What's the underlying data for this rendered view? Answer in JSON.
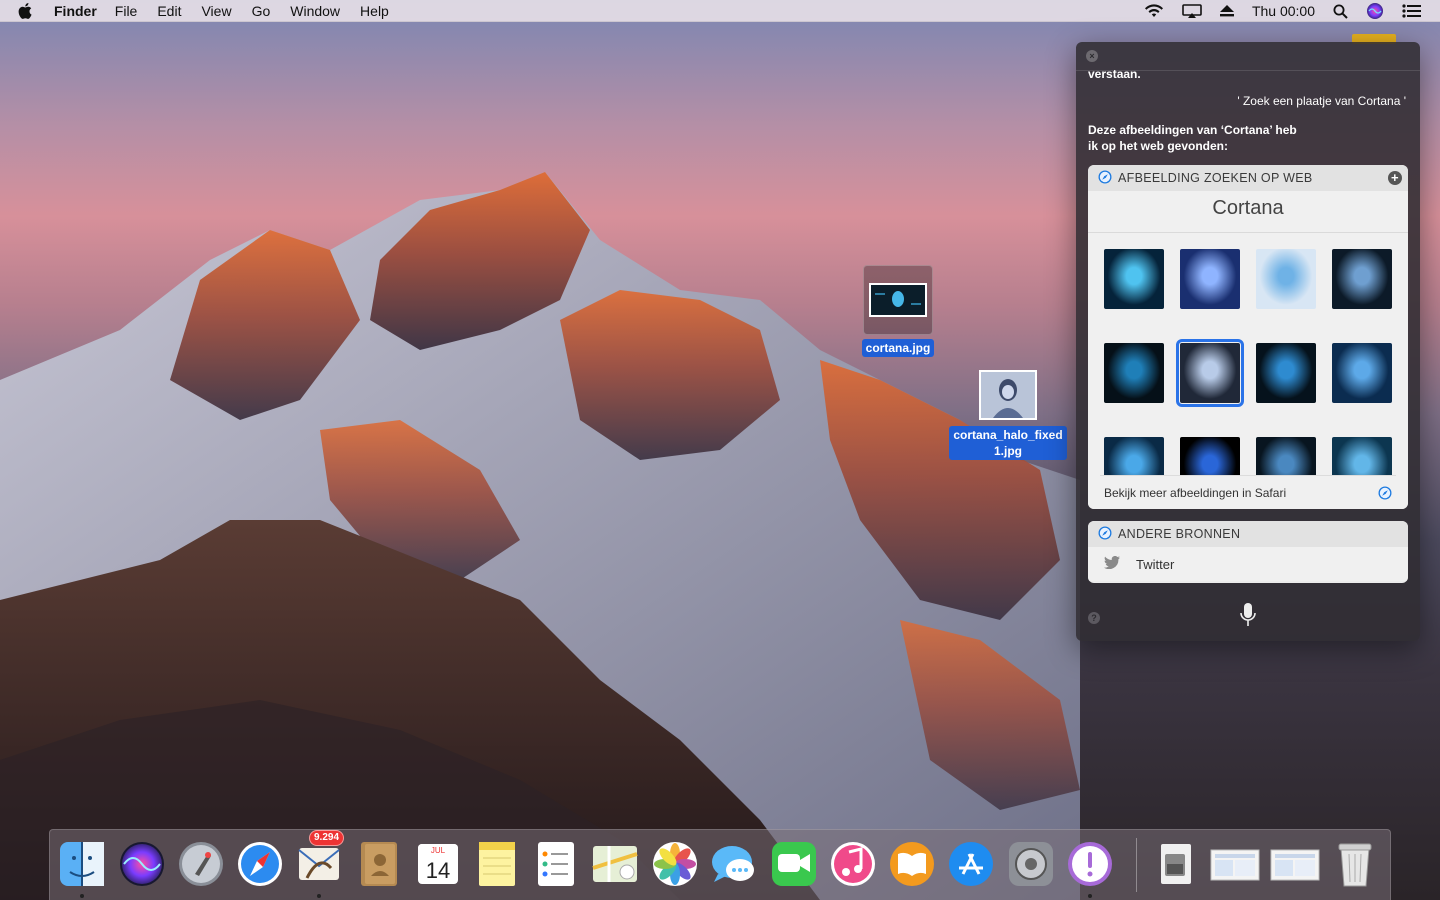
{
  "menubar": {
    "app_name": "Finder",
    "menus": [
      "File",
      "Edit",
      "View",
      "Go",
      "Window",
      "Help"
    ],
    "clock": "Thu 00:00",
    "icons": [
      "apple-icon",
      "wifi-icon",
      "airplay-icon",
      "eject-icon",
      "spotlight-icon",
      "siri-icon",
      "notification-center-icon"
    ]
  },
  "desktop": {
    "files": [
      {
        "name": "cortana.jpg"
      },
      {
        "name": "cortana_halo_fixed",
        "name_line2": "1.jpg"
      }
    ]
  },
  "siri": {
    "top_cut_text": "verstaan.",
    "user_query": "' Zoek een plaatje van Cortana '",
    "reply": "Deze afbeeldingen van ‘Cortana’ heb ik op het web gevonden:",
    "image_card": {
      "header": "AFBEELDING ZOEKEN OP WEB",
      "search_term": "Cortana",
      "image_count": 12,
      "selected_index": 5,
      "more_link": "Bekijk meer afbeeldingen in Safari"
    },
    "sources_card": {
      "header": "ANDERE BRONNEN",
      "items": [
        "Twitter"
      ]
    }
  },
  "dock": {
    "apps": [
      {
        "name": "Finder",
        "icon": "finder-icon",
        "running": true
      },
      {
        "name": "Siri",
        "icon": "siri-icon",
        "running": false
      },
      {
        "name": "Launchpad",
        "icon": "launchpad-icon",
        "running": false
      },
      {
        "name": "Safari",
        "icon": "safari-icon",
        "running": false
      },
      {
        "name": "Mail",
        "icon": "mail-icon",
        "running": true,
        "badge": "9.294"
      },
      {
        "name": "Contacts",
        "icon": "contacts-icon",
        "running": false
      },
      {
        "name": "Calendar",
        "icon": "calendar-icon",
        "running": false,
        "month": "JUL",
        "day": "14"
      },
      {
        "name": "Notes",
        "icon": "notes-icon",
        "running": false
      },
      {
        "name": "Reminders",
        "icon": "reminders-icon",
        "running": false
      },
      {
        "name": "Maps",
        "icon": "maps-icon",
        "running": false
      },
      {
        "name": "Photos",
        "icon": "photos-icon",
        "running": false
      },
      {
        "name": "Messages",
        "icon": "messages-icon",
        "running": false
      },
      {
        "name": "FaceTime",
        "icon": "facetime-icon",
        "running": false
      },
      {
        "name": "iTunes",
        "icon": "itunes-icon",
        "running": false
      },
      {
        "name": "iBooks",
        "icon": "ibooks-icon",
        "running": false
      },
      {
        "name": "App Store",
        "icon": "app-store-icon",
        "running": false
      },
      {
        "name": "System Preferences",
        "icon": "system-preferences-icon",
        "running": false
      },
      {
        "name": "Feedback Assistant",
        "icon": "feedback-icon",
        "running": true
      },
      {
        "name": "Downloads",
        "icon": "downloads-stack-icon",
        "running": false
      },
      {
        "name": "Screenshot 1",
        "icon": "screenshot-stack-icon",
        "running": false
      },
      {
        "name": "Screenshot 2",
        "icon": "screenshot-stack-icon",
        "running": false
      },
      {
        "name": "Trash",
        "icon": "trash-icon",
        "running": false
      }
    ]
  }
}
